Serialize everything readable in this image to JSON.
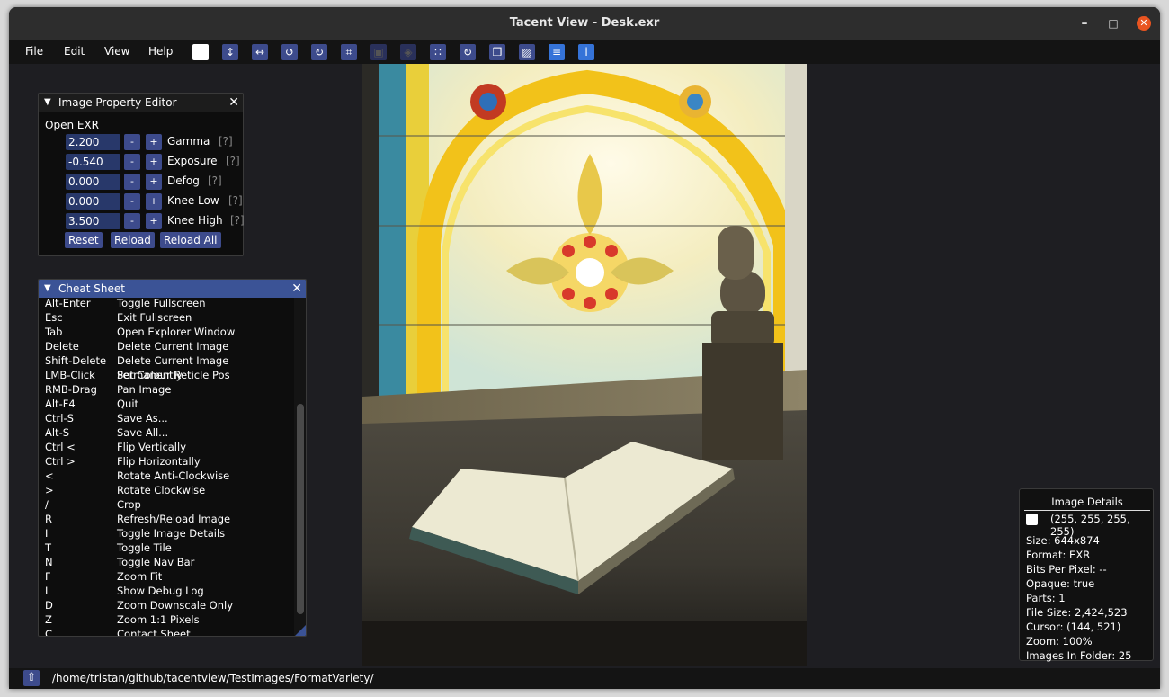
{
  "window": {
    "title": "Tacent View - Desk.exr",
    "minimize": "–",
    "maximize": "□",
    "close": "✕"
  },
  "menu": [
    "File",
    "Edit",
    "View",
    "Help"
  ],
  "toolbar": [
    {
      "name": "colour-swatch-icon",
      "glyph": ""
    },
    {
      "name": "flip-vertical-icon",
      "glyph": "↕"
    },
    {
      "name": "flip-horizontal-icon",
      "glyph": "↔"
    },
    {
      "name": "rotate-anticlockwise-icon",
      "glyph": "↺"
    },
    {
      "name": "rotate-clockwise-icon",
      "glyph": "↻"
    },
    {
      "name": "crop-icon",
      "glyph": "⌗"
    },
    {
      "name": "frame-icon",
      "glyph": "▣"
    },
    {
      "name": "cube-icon",
      "glyph": "◈"
    },
    {
      "name": "tile-grid-icon",
      "glyph": "∷"
    },
    {
      "name": "refresh-icon",
      "glyph": "↻"
    },
    {
      "name": "delete-icon",
      "glyph": "❒"
    },
    {
      "name": "content-view-icon",
      "glyph": "▨"
    },
    {
      "name": "settings-sliders-icon",
      "glyph": "≡"
    },
    {
      "name": "info-icon",
      "glyph": "i"
    }
  ],
  "property_editor": {
    "title": "Image Property Editor",
    "subtitle": "Open EXR",
    "rows": [
      {
        "value": "2.200",
        "label": "Gamma"
      },
      {
        "value": "-0.540",
        "label": "Exposure"
      },
      {
        "value": "0.000",
        "label": "Defog"
      },
      {
        "value": "0.000",
        "label": "Knee Low"
      },
      {
        "value": "3.500",
        "label": "Knee High"
      }
    ],
    "minus": "-",
    "plus": "+",
    "help": "[?]",
    "buttons": {
      "reset": "Reset",
      "reload": "Reload",
      "reload_all": "Reload All"
    }
  },
  "cheat_sheet": {
    "title": "Cheat Sheet",
    "rows": [
      [
        "Alt-Enter",
        "Toggle Fullscreen"
      ],
      [
        "Esc",
        "Exit Fullscreen"
      ],
      [
        "Tab",
        "Open Explorer Window"
      ],
      [
        "Delete",
        "Delete Current Image"
      ],
      [
        "Shift-Delete",
        "Delete Current Image Permanently"
      ],
      [
        "LMB-Click",
        "Set Colour Reticle Pos"
      ],
      [
        "RMB-Drag",
        "Pan Image"
      ],
      [
        "Alt-F4",
        "Quit"
      ],
      [
        "Ctrl-S",
        "Save As..."
      ],
      [
        "Alt-S",
        "Save All..."
      ],
      [
        "Ctrl <",
        "Flip Vertically"
      ],
      [
        "Ctrl >",
        "Flip Horizontally"
      ],
      [
        "<",
        "Rotate Anti-Clockwise"
      ],
      [
        ">",
        "Rotate Clockwise"
      ],
      [
        "/",
        "Crop"
      ],
      [
        "R",
        "Refresh/Reload Image"
      ],
      [
        "I",
        "Toggle Image Details"
      ],
      [
        "T",
        "Toggle Tile"
      ],
      [
        "N",
        "Toggle Nav Bar"
      ],
      [
        "F",
        "Zoom Fit"
      ],
      [
        "L",
        "Show Debug Log"
      ],
      [
        "D",
        "Zoom Downscale Only"
      ],
      [
        "Z",
        "Zoom 1:1 Pixels"
      ],
      [
        "C",
        "Contact Sheet..."
      ]
    ]
  },
  "details": {
    "title": "Image   Details",
    "colour": "(255, 255, 255, 255)",
    "lines": [
      "Size: 644x874",
      "Format: EXR",
      "Bits Per Pixel: --",
      "Opaque: true",
      "Parts: 1",
      "File Size: 2,424,523",
      "Cursor: (144, 521)",
      "Zoom: 100%",
      "Images In Folder: 25"
    ]
  },
  "status": {
    "path": "/home/tristan/github/tacentview/TestImages/FormatVariety/"
  }
}
